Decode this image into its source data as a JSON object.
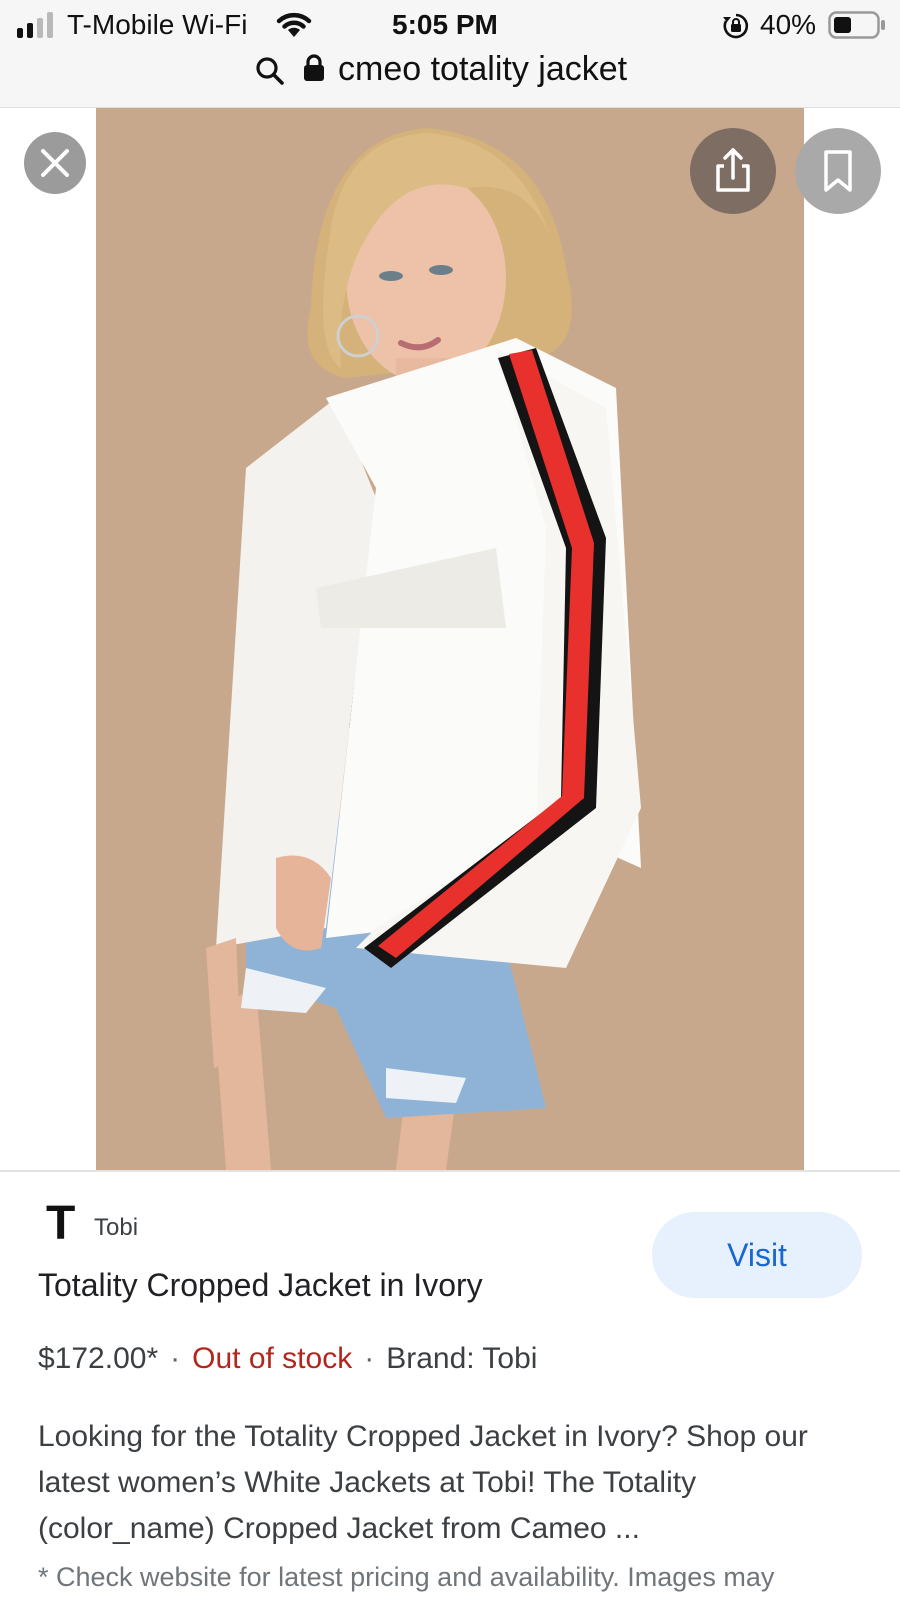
{
  "status_bar": {
    "carrier": "T-Mobile Wi-Fi",
    "time": "5:05 PM",
    "battery": "40%"
  },
  "url_bar": {
    "query": "cmeo totality jacket"
  },
  "result": {
    "site_logo": "T",
    "site_name": "Tobi",
    "title": "Totality Cropped Jacket in Ivory",
    "price": "$172.00*",
    "stock_status": "Out of stock",
    "separator": "·",
    "brand": "Brand: Tobi",
    "description": "Looking for the Totality Cropped Jacket in Ivory? Shop our latest women’s White Jackets at Tobi! The Totality (color_name) Cropped Jacket from Cameo ...",
    "disclaimer": "* Check website for latest pricing and availability. Images may",
    "visit_label": "Visit"
  },
  "icons": {
    "close": "close-icon",
    "share": "share-icon",
    "bookmark": "bookmark-icon",
    "search": "search-icon",
    "lock": "lock-icon",
    "wifi": "wifi-icon",
    "battery": "battery-icon",
    "rotation_lock": "rotation-lock-icon"
  },
  "colors": {
    "out_of_stock": "#b3261e",
    "visit_button_bg": "#e7f0fd",
    "visit_button_text": "#1967d2",
    "photo_background": "#c8a88d"
  }
}
